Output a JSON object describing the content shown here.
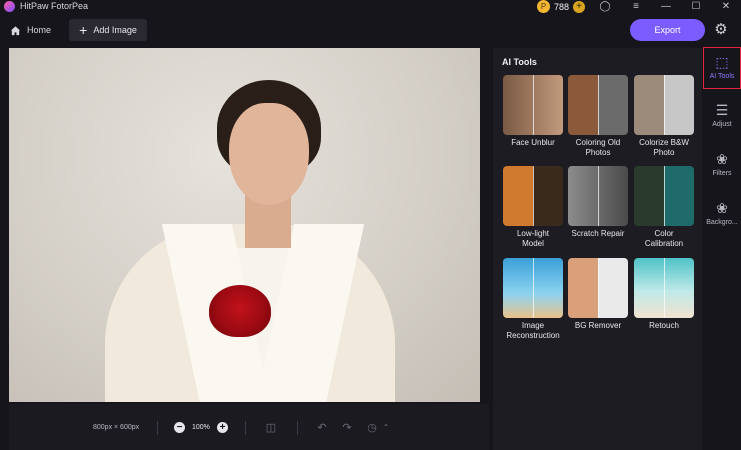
{
  "app": {
    "title": "HitPaw FotorPea"
  },
  "titlebar": {
    "coins": "788",
    "coin_symbol": "P",
    "coin_add": "+"
  },
  "toolbar": {
    "home_label": "Home",
    "add_image_label": "Add Image",
    "export_label": "Export"
  },
  "status": {
    "dimensions": "800px × 600px",
    "zoom": "100%"
  },
  "panel": {
    "title": "AI Tools",
    "tools": [
      {
        "label": "Face Unblur"
      },
      {
        "label": "Coloring Old\nPhotos"
      },
      {
        "label": "Colorize B&W\nPhoto"
      },
      {
        "label": "Low-light\nModel"
      },
      {
        "label": "Scratch Repair"
      },
      {
        "label": "Color\nCalibration"
      },
      {
        "label": "Image\nReconstruction"
      },
      {
        "label": "BG Remover"
      },
      {
        "label": "Retouch"
      }
    ]
  },
  "rail": {
    "items": [
      {
        "label": "AI Tools",
        "icon": "ai-tools-icon"
      },
      {
        "label": "Adjust",
        "icon": "sliders-icon"
      },
      {
        "label": "Filters",
        "icon": "filters-icon"
      },
      {
        "label": "Backgro...",
        "icon": "background-icon"
      }
    ]
  },
  "colors": {
    "accent": "#7b5cff",
    "active_outline": "#e0283a"
  }
}
